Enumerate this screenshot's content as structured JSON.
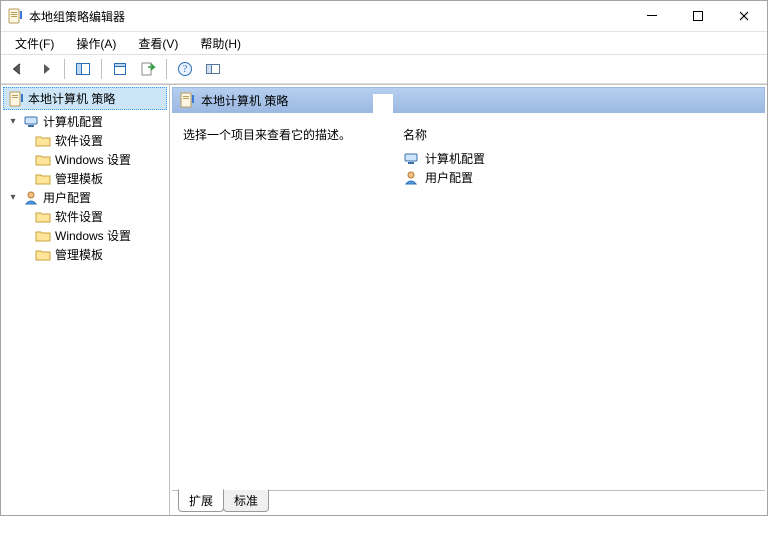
{
  "window": {
    "title": "本地组策略编辑器"
  },
  "menu": {
    "file": "文件(F)",
    "action": "操作(A)",
    "view": "查看(V)",
    "help": "帮助(H)"
  },
  "tree": {
    "root": "本地计算机 策略",
    "nodes": [
      {
        "label": "计算机配置",
        "children": [
          "软件设置",
          "Windows 设置",
          "管理模板"
        ]
      },
      {
        "label": "用户配置",
        "children": [
          "软件设置",
          "Windows 设置",
          "管理模板"
        ]
      }
    ]
  },
  "detail": {
    "heading": "本地计算机 策略",
    "hint": "选择一个项目来查看它的描述。",
    "column_name": "名称",
    "items": [
      {
        "label": "计算机配置"
      },
      {
        "label": "用户配置"
      }
    ]
  },
  "tabs": {
    "extended": "扩展",
    "standard": "标准"
  }
}
